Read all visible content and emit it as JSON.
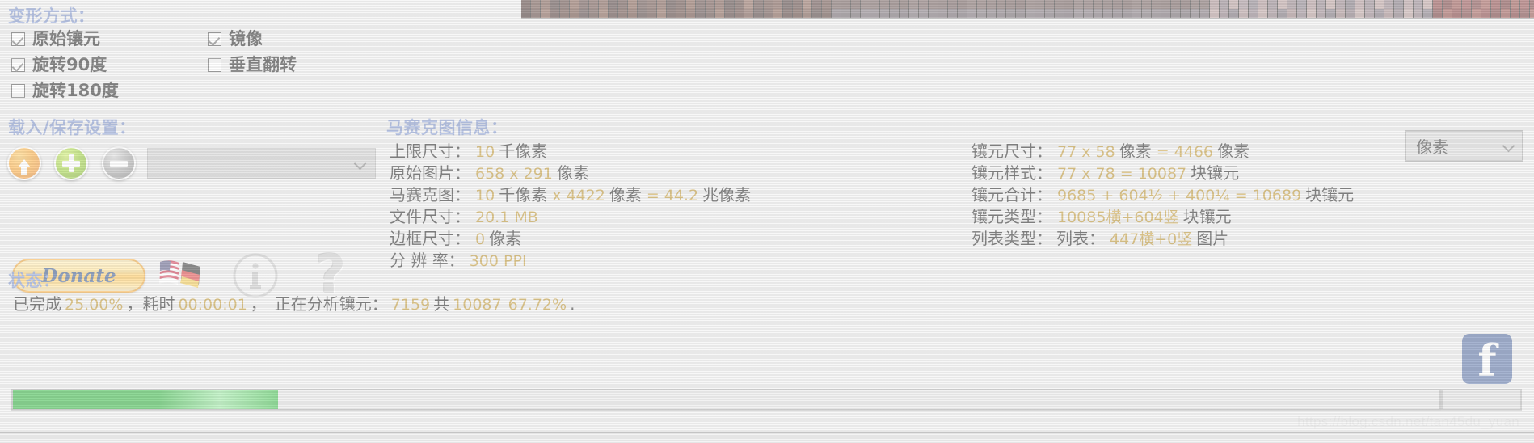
{
  "transform": {
    "heading": "变形方式：",
    "options": [
      {
        "label": "原始镶元",
        "checked": true
      },
      {
        "label": "旋转90度",
        "checked": true
      },
      {
        "label": "旋转180度",
        "checked": false
      },
      {
        "label": "镜像",
        "checked": true
      },
      {
        "label": "垂直翻转",
        "checked": false
      }
    ]
  },
  "loadsave": {
    "heading": "载入/保存设置：",
    "load_icon": "orange-up-arrow-icon",
    "add_icon": "green-plus-icon",
    "remove_icon": "grey-minus-icon",
    "combo_value": "",
    "combo_chevron": "chevron-down-icon"
  },
  "actions": {
    "donate_label": "Donate",
    "flags_icon": "us-de-flags-icon",
    "info_icon": "info-circle-icon",
    "help_icon": "question-mark-icon",
    "help_glyph": "?",
    "facebook_icon": "facebook-icon",
    "facebook_glyph": "f"
  },
  "unit_dropdown": {
    "value": "像素",
    "chevron": "chevron-down-icon"
  },
  "mosaic_info": {
    "heading": "马赛克图信息：",
    "left": [
      {
        "key": "上限尺寸：",
        "value": "10",
        "unit": "千像素"
      },
      {
        "key": "原始图片：",
        "value": "658 x 291",
        "unit": "像素"
      },
      {
        "key": "马赛克图：",
        "value": "10",
        "unit": "千像素",
        "value2": "x 4422",
        "unit2": "像素",
        "value3": "= 44.2",
        "unit3": "兆像素"
      },
      {
        "key": "文件尺寸：",
        "value": "20.1 MB",
        "unit": ""
      },
      {
        "key": "边框尺寸：",
        "value": "0",
        "unit": "像素"
      },
      {
        "key": "分 辨 率：",
        "value": "300 PPI",
        "unit": ""
      }
    ],
    "right": [
      {
        "key": "镶元尺寸：",
        "value": "77 x 58",
        "unit": "像素",
        "value2": "= 4466",
        "unit2": "像素"
      },
      {
        "key": "镶元样式：",
        "value": "77 x 78 = 10087",
        "unit": "块镶元"
      },
      {
        "key": "镶元合计：",
        "value": "9685 + 604½ + 400¼ = 10689",
        "unit": "块镶元"
      },
      {
        "key": "镶元类型：",
        "value": "10085横+604竖",
        "unit": "块镶元"
      },
      {
        "key": "列表类型：",
        "value": "列表：",
        "unit": "",
        "value2": "447横+0竖",
        "unit2": "图片"
      }
    ]
  },
  "status": {
    "heading": "状态：",
    "done_prefix": "已完成",
    "done_percent": "25.00%",
    "sep1": "，",
    "elapsed_label": "耗时",
    "elapsed_value": "00:00:01",
    "sep2": "，",
    "analyzing_label": "正在分析镶元：",
    "current": "7159",
    "total_label": "共",
    "total": "10087",
    "sub_percent": "67.72%",
    "trailing": "."
  },
  "progress": {
    "percent": 18.6,
    "fill_color": "#0aa81b"
  },
  "watermark": {
    "text": "https://blog.csdn.net/tan45du_yuan"
  },
  "colors": {
    "heading_blue": "#6a84c8",
    "value_gold": "#b8860b",
    "facebook_blue": "#3b5998",
    "donate_orange": "#f29a16",
    "progress_green": "#0aa81b"
  }
}
